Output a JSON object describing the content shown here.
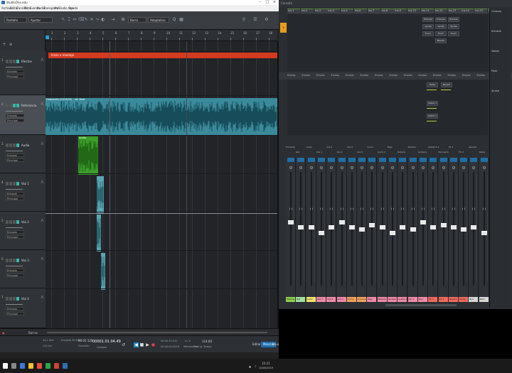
{
  "daw": {
    "title": "StudioOne.edu",
    "menu": [
      "Archivo",
      "Editar",
      "Canción",
      "Pista",
      "Evento",
      "Audio",
      "Transporte",
      "Ver",
      "Studio One",
      "Ayuda"
    ],
    "toolbar": {
      "drop1": "Pantalla",
      "drop2": "Ajustar",
      "snap": "Barra",
      "quantize": "Adaptativo"
    },
    "ruler_numbers": [
      "1",
      "2",
      "3",
      "4",
      "5",
      "6",
      "7",
      "8",
      "9",
      "10",
      "11",
      "12",
      "13",
      "14",
      "15",
      "16",
      "17",
      "18"
    ],
    "marker_label": "Inicio a montaje",
    "tracks": [
      {
        "num": "1",
        "name": "Efectos",
        "io1": "Entrada",
        "io2": "Principal",
        "selected": false
      },
      {
        "num": "2",
        "name": "Referencia",
        "io1": "Entrada",
        "io2": "Principal",
        "selected": true
      },
      {
        "num": "3",
        "name": "Audio",
        "io1": "Entrada",
        "io2": "Principal",
        "selected": false
      },
      {
        "num": "4",
        "name": "Voz 1",
        "io1": "Entrada",
        "io2": "Principal",
        "selected": false
      },
      {
        "num": "5",
        "name": "Voz 2",
        "io1": "Entrada",
        "io2": "Principal",
        "selected": false
      },
      {
        "num": "6",
        "name": "Voz 3",
        "io1": "Entrada",
        "io2": "Principal",
        "selected": false
      },
      {
        "num": "7",
        "name": "Voz 4",
        "io1": "Entrada",
        "io2": "Principal",
        "selected": false
      }
    ],
    "clips": {
      "main": "Grabación (2019/05) - ref. Beat",
      "green": "Audio",
      "teal": "Voz"
    },
    "bottom_strip": {
      "label": "Barras"
    },
    "transport": {
      "sample_rate": "44.1 kHz",
      "length": "124 ms",
      "latency": "Enviado 40 kHz",
      "time_a": "00:01:120",
      "time_b": "Duración",
      "position": "00001.01.04.49",
      "position_sub": "Compás",
      "pos2": "00:00:31:012",
      "pos3": "00:40:00:2518",
      "bpm": "4 / 4",
      "tempo": "114.00",
      "key": "Metronomo",
      "timing": "Timing",
      "tempo_label": "Tempo",
      "tab_edit": "Editar",
      "tab_mix": "Mezclar",
      "tab_browse": "Navegar"
    }
  },
  "mixer": {
    "title": "Consola",
    "insert_row": [
      "Ins.1",
      "Ins.2",
      "Ins.3",
      "Ins.4",
      "Ins.5",
      "Ins.6",
      "Ins.7",
      "Ins.8",
      "Ins.9",
      "Ins.10",
      "Ins.11",
      "Ins.12",
      "Ins.13",
      "Ins.14",
      "Ins.15",
      "Ins.16"
    ],
    "upper_cells": [
      "Entrada",
      "Entrada",
      "Entrada",
      "Ajuste",
      "Ajuste",
      "Ajuste",
      "Envío",
      "Envío",
      "Envío",
      "Reverb"
    ],
    "sep_labels": [
      "Envíos",
      "Envíos",
      "Envíos",
      "Envíos",
      "Envíos",
      "Envíos",
      "Envíos",
      "Envíos",
      "Envíos",
      "Envíos",
      "Envíos",
      "Envíos",
      "Envíos",
      "Envíos"
    ],
    "mid_cells": [
      "Delay",
      "Reverb",
      "Salida 1",
      "Salida 2"
    ],
    "right_col": [
      "Consola",
      "Entrada",
      "Salida",
      "Pista",
      "Ajuste"
    ],
    "channel_names": [
      "Principal",
      "Ref",
      "Audio",
      "Voz 1",
      "Voz 2",
      "Voz 3",
      "Voz 4",
      "Voz 5",
      "Coros",
      "Coros 2",
      "Bajo",
      "Batería",
      "Teclado",
      "Guitarra",
      "Guitarra 2",
      "Percusión",
      "FX 1",
      "FX 2",
      "Reverb",
      "Delay"
    ],
    "channel_tags": [
      {
        "label": "Efectos",
        "color": "#8fd14f"
      },
      {
        "label": "Ref",
        "color": "#a2e0a0"
      },
      {
        "label": "Audio",
        "color": "#f5e66b"
      },
      {
        "label": "Voz 1",
        "color": "#f08aa8"
      },
      {
        "label": "Voz 2",
        "color": "#f08aa8"
      },
      {
        "label": "Voz 3",
        "color": "#f08aa8"
      },
      {
        "label": "Coros",
        "color": "#f3a35f"
      },
      {
        "label": "Coros 2",
        "color": "#f3a35f"
      },
      {
        "label": "Bajo",
        "color": "#f08aa8"
      },
      {
        "label": "Batería",
        "color": "#f08aa8"
      },
      {
        "label": "Teclado",
        "color": "#f08aa8"
      },
      {
        "label": "Guitarra",
        "color": "#f08aa8"
      },
      {
        "label": "Gtr 2",
        "color": "#f08aa8"
      },
      {
        "label": "Perc",
        "color": "#f08aa8"
      },
      {
        "label": "FX 1",
        "color": "#f06a5c"
      },
      {
        "label": "FX 2",
        "color": "#f06a5c"
      },
      {
        "label": "Reverb",
        "color": "#f06a5c"
      },
      {
        "label": "Delay",
        "color": "#f06a5c"
      },
      {
        "label": "Bus",
        "color": "#d6d6d6"
      },
      {
        "label": "Main",
        "color": "#d6d6d6"
      }
    ],
    "fader_levels": [
      0.55,
      0.5,
      0.5,
      0.45,
      0.5,
      0.55,
      0.5,
      0.48,
      0.52,
      0.5,
      0.45,
      0.5,
      0.48,
      0.55,
      0.5,
      0.52,
      0.5,
      0.48,
      0.5,
      0.45
    ]
  },
  "taskbar": {
    "clock": "15:21",
    "date": "10/05/2019"
  },
  "colors": {
    "accent": "#1d8fd0",
    "marker": "#d33a1f",
    "clip_main": "#3b8a9c",
    "clip_green": "#3b9e2a",
    "mixer_orange": "#e89b1c"
  }
}
